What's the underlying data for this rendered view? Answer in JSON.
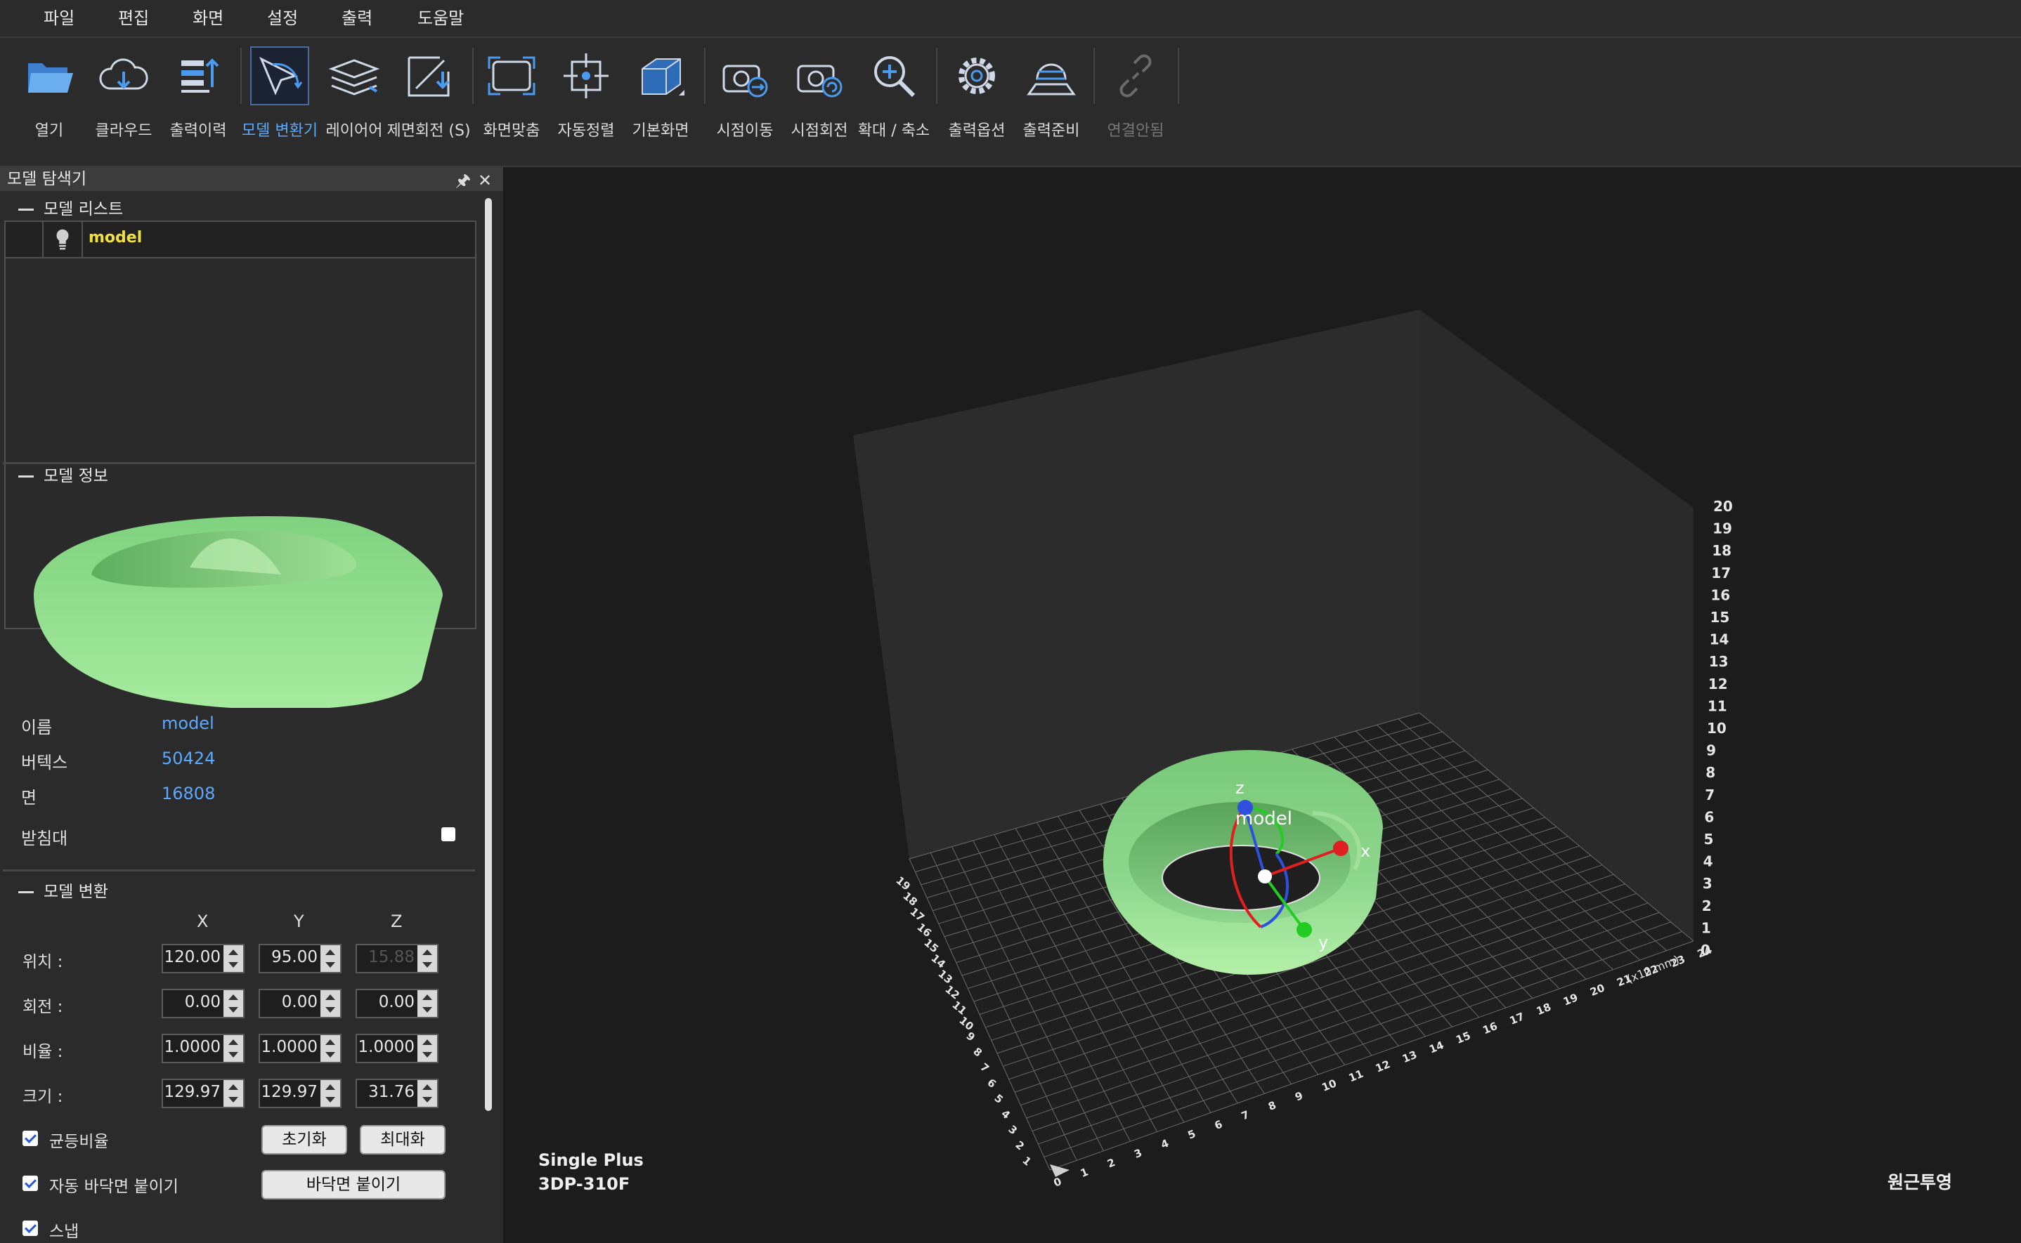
{
  "menu": [
    "파일",
    "편집",
    "화면",
    "설정",
    "출력",
    "도움말"
  ],
  "toolbar": [
    {
      "label": "열기",
      "icon": "folder-open-icon"
    },
    {
      "label": "클라우드",
      "icon": "cloud-download-icon"
    },
    {
      "label": "출력이력",
      "icon": "print-history-icon"
    },
    {
      "label": "모델 변환기",
      "icon": "model-transform-icon",
      "active": true
    },
    {
      "label": "레이어어",
      "icon": "layers-icon"
    },
    {
      "label": "제면회전 (S)",
      "icon": "face-rotate-icon"
    },
    {
      "label": "화면맞춤",
      "icon": "fit-screen-icon"
    },
    {
      "label": "자동정렬",
      "icon": "auto-align-icon"
    },
    {
      "label": "기본화면",
      "icon": "default-view-icon"
    },
    {
      "label": "시점이동",
      "icon": "view-pan-icon"
    },
    {
      "label": "시점회전",
      "icon": "view-rotate-icon"
    },
    {
      "label": "확대 / 축소",
      "icon": "zoom-icon"
    },
    {
      "label": "출력옵션",
      "icon": "print-options-icon"
    },
    {
      "label": "출력준비",
      "icon": "print-prepare-icon"
    },
    {
      "label": "연결안됨",
      "icon": "disconnected-icon",
      "disabled": true
    }
  ],
  "panel": {
    "title": "모델 탐색기",
    "list_heading": "모델 리스트",
    "model_name": "model",
    "info_heading": "모델 정보",
    "info": {
      "name_label": "이름",
      "name_value": "model",
      "vertex_label": "버텍스",
      "vertex_value": "50424",
      "face_label": "면",
      "face_value": "16808",
      "support_label": "받침대"
    },
    "transform_heading": "모델 변환",
    "axes": {
      "x": "X",
      "y": "Y",
      "z": "Z"
    },
    "rows": {
      "position_label": "위치 :",
      "position": [
        "120.00",
        "95.00",
        "15.88"
      ],
      "rotation_label": "회전 :",
      "rotation": [
        "0.00",
        "0.00",
        "0.00"
      ],
      "scale_label": "비율 :",
      "scale": [
        "1.0000",
        "1.0000",
        "1.0000"
      ],
      "size_label": "크기 :",
      "size": [
        "129.97",
        "129.97",
        "31.76"
      ]
    },
    "uniform_label": "균등비율",
    "reset_button": "초기화",
    "max_button": "최대화",
    "auto_floor_label": "자동 바닥면 붙이기",
    "floor_button": "바닥면 붙이기",
    "snap_label": "스냅"
  },
  "viewport": {
    "printer_line1": "Single Plus",
    "printer_line2": "3DP-310F",
    "projection": "원근투영",
    "model_label": "model",
    "gizmo_x": "x",
    "gizmo_y": "y",
    "gizmo_z": "z",
    "x_unit": "(x10 mm)",
    "z_ticks": [
      "0",
      "1",
      "2",
      "3",
      "4",
      "5",
      "6",
      "7",
      "8",
      "9",
      "10",
      "11",
      "12",
      "13",
      "14",
      "15",
      "16",
      "17",
      "18",
      "19",
      "20"
    ],
    "x_ticks": [
      "0",
      "1",
      "2",
      "3",
      "4",
      "5",
      "6",
      "7",
      "8",
      "9",
      "10",
      "11",
      "12",
      "13",
      "14",
      "15",
      "16",
      "17",
      "18",
      "19",
      "20",
      "21",
      "22",
      "23",
      "24"
    ],
    "y_ticks": [
      "1",
      "2",
      "3",
      "4",
      "5",
      "6",
      "7",
      "8",
      "9",
      "10",
      "11",
      "12",
      "13",
      "14",
      "15",
      "16",
      "17",
      "18",
      "19"
    ],
    "colors": {
      "model": "#8fd88f",
      "accent": "#5aa9ff",
      "selected_name": "#f0e040"
    }
  }
}
